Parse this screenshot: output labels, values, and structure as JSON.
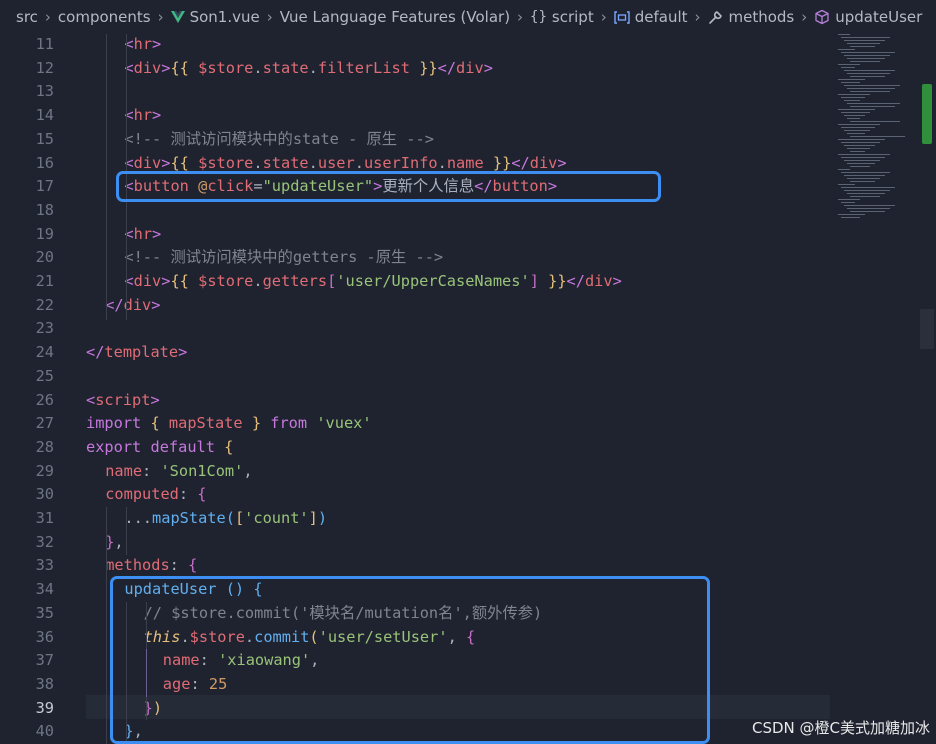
{
  "breadcrumb": {
    "items": [
      {
        "label": "src",
        "icon": ""
      },
      {
        "label": "components",
        "icon": ""
      },
      {
        "label": "Son1.vue",
        "icon": "vue-icon"
      },
      {
        "label": "Vue Language Features (Volar)",
        "icon": ""
      },
      {
        "label": "script",
        "icon": "braces-icon"
      },
      {
        "label": "default",
        "icon": "module-icon"
      },
      {
        "label": "methods",
        "icon": "wrench-icon"
      },
      {
        "label": "updateUser",
        "icon": "cube-icon"
      }
    ]
  },
  "editor": {
    "active_line": "39",
    "lines": [
      {
        "n": "11",
        "indent": 2,
        "tokens": [
          [
            "p",
            "<"
          ],
          [
            "c",
            "hr"
          ],
          [
            "p",
            ">"
          ]
        ]
      },
      {
        "n": "12",
        "indent": 2,
        "tokens": [
          [
            "p",
            "<"
          ],
          [
            "c",
            "div"
          ],
          [
            "p",
            ">"
          ],
          [
            "b",
            "{{"
          ],
          [
            "d",
            " "
          ],
          [
            "c",
            "$store"
          ],
          [
            "d",
            "."
          ],
          [
            "c",
            "state"
          ],
          [
            "d",
            "."
          ],
          [
            "c",
            "filterList"
          ],
          [
            "d",
            " "
          ],
          [
            "b",
            "}}"
          ],
          [
            "p",
            "</"
          ],
          [
            "c",
            "div"
          ],
          [
            "p",
            ">"
          ]
        ]
      },
      {
        "n": "13",
        "indent": 0,
        "tokens": []
      },
      {
        "n": "14",
        "indent": 2,
        "tokens": [
          [
            "p",
            "<"
          ],
          [
            "c",
            "hr"
          ],
          [
            "p",
            ">"
          ]
        ]
      },
      {
        "n": "15",
        "indent": 2,
        "tokens": [
          [
            "m",
            "<!-- 测试访问模块中的state - 原生 -->"
          ]
        ]
      },
      {
        "n": "16",
        "indent": 2,
        "tokens": [
          [
            "p",
            "<"
          ],
          [
            "c",
            "div"
          ],
          [
            "p",
            ">"
          ],
          [
            "b",
            "{{"
          ],
          [
            "d",
            " "
          ],
          [
            "c",
            "$store"
          ],
          [
            "d",
            "."
          ],
          [
            "c",
            "state"
          ],
          [
            "d",
            "."
          ],
          [
            "c",
            "user"
          ],
          [
            "d",
            "."
          ],
          [
            "c",
            "userInfo"
          ],
          [
            "d",
            "."
          ],
          [
            "c",
            "name"
          ],
          [
            "d",
            " "
          ],
          [
            "b",
            "}}"
          ],
          [
            "p",
            "</"
          ],
          [
            "c",
            "div"
          ],
          [
            "p",
            ">"
          ]
        ]
      },
      {
        "n": "17",
        "indent": 2,
        "tokens": [
          [
            "p",
            "<"
          ],
          [
            "c",
            "button"
          ],
          [
            "d",
            " "
          ],
          [
            "n",
            "@"
          ],
          [
            "c",
            "click"
          ],
          [
            "d",
            "="
          ],
          [
            "s",
            "\"updateUser\""
          ],
          [
            "p",
            ">"
          ],
          [
            "d",
            "更新个人信息"
          ],
          [
            "p",
            "</"
          ],
          [
            "c",
            "button"
          ],
          [
            "p",
            ">"
          ]
        ]
      },
      {
        "n": "18",
        "indent": 0,
        "tokens": []
      },
      {
        "n": "19",
        "indent": 2,
        "tokens": [
          [
            "p",
            "<"
          ],
          [
            "c",
            "hr"
          ],
          [
            "p",
            ">"
          ]
        ]
      },
      {
        "n": "20",
        "indent": 2,
        "tokens": [
          [
            "m",
            "<!-- 测试访问模块中的getters -原生 -->"
          ]
        ]
      },
      {
        "n": "21",
        "indent": 2,
        "tokens": [
          [
            "p",
            "<"
          ],
          [
            "c",
            "div"
          ],
          [
            "p",
            ">"
          ],
          [
            "b",
            "{{"
          ],
          [
            "d",
            " "
          ],
          [
            "c",
            "$store"
          ],
          [
            "d",
            "."
          ],
          [
            "c",
            "getters"
          ],
          [
            "k",
            "["
          ],
          [
            "s",
            "'user/UpperCaseNames'"
          ],
          [
            "k",
            "]"
          ],
          [
            "d",
            " "
          ],
          [
            "b",
            "}}"
          ],
          [
            "p",
            "</"
          ],
          [
            "c",
            "div"
          ],
          [
            "p",
            ">"
          ]
        ]
      },
      {
        "n": "22",
        "indent": 1,
        "tokens": [
          [
            "p",
            "</"
          ],
          [
            "c",
            "div"
          ],
          [
            "p",
            ">"
          ]
        ]
      },
      {
        "n": "23",
        "indent": 0,
        "tokens": []
      },
      {
        "n": "24",
        "indent": 0,
        "tokens": [
          [
            "p",
            "</"
          ],
          [
            "c",
            "template"
          ],
          [
            "p",
            ">"
          ]
        ]
      },
      {
        "n": "25",
        "indent": 0,
        "tokens": []
      },
      {
        "n": "26",
        "indent": 0,
        "tokens": [
          [
            "p",
            "<"
          ],
          [
            "c",
            "script"
          ],
          [
            "p",
            ">"
          ]
        ]
      },
      {
        "n": "27",
        "indent": 0,
        "tokens": [
          [
            "u",
            "import"
          ],
          [
            "d",
            " "
          ],
          [
            "b",
            "{"
          ],
          [
            "d",
            " "
          ],
          [
            "c",
            "mapState"
          ],
          [
            "d",
            " "
          ],
          [
            "b",
            "}"
          ],
          [
            "d",
            " "
          ],
          [
            "u",
            "from"
          ],
          [
            "d",
            " "
          ],
          [
            "s",
            "'vuex'"
          ]
        ]
      },
      {
        "n": "28",
        "indent": 0,
        "tokens": [
          [
            "u",
            "export"
          ],
          [
            "d",
            " "
          ],
          [
            "u",
            "default"
          ],
          [
            "d",
            " "
          ],
          [
            "b",
            "{"
          ]
        ]
      },
      {
        "n": "29",
        "indent": 1,
        "tokens": [
          [
            "c",
            "name"
          ],
          [
            "d",
            ": "
          ],
          [
            "s",
            "'Son1Com'"
          ],
          [
            "d",
            ","
          ]
        ]
      },
      {
        "n": "30",
        "indent": 1,
        "tokens": [
          [
            "c",
            "computed"
          ],
          [
            "d",
            ": "
          ],
          [
            "k",
            "{"
          ]
        ]
      },
      {
        "n": "31",
        "indent": 2,
        "tokens": [
          [
            "d",
            "..."
          ],
          [
            "f",
            "mapState"
          ],
          [
            "f",
            "("
          ],
          [
            "b",
            "["
          ],
          [
            "s",
            "'count'"
          ],
          [
            "b",
            "]"
          ],
          [
            "f",
            ")"
          ]
        ]
      },
      {
        "n": "32",
        "indent": 1,
        "tokens": [
          [
            "k",
            "}"
          ],
          [
            "d",
            ","
          ]
        ]
      },
      {
        "n": "33",
        "indent": 1,
        "tokens": [
          [
            "c",
            "methods"
          ],
          [
            "d",
            ": "
          ],
          [
            "k",
            "{"
          ]
        ]
      },
      {
        "n": "34",
        "indent": 2,
        "tokens": [
          [
            "f",
            "updateUser"
          ],
          [
            "d",
            " "
          ],
          [
            "f",
            "()"
          ],
          [
            "d",
            " "
          ],
          [
            "f",
            "{"
          ]
        ]
      },
      {
        "n": "35",
        "indent": 3,
        "tokens": [
          [
            "m",
            "// $store.commit('模块名/mutation名',额外传参)"
          ]
        ]
      },
      {
        "n": "36",
        "indent": 3,
        "tokens": [
          [
            "i",
            "this"
          ],
          [
            "d",
            "."
          ],
          [
            "c",
            "$store"
          ],
          [
            "d",
            "."
          ],
          [
            "f",
            "commit"
          ],
          [
            "b",
            "("
          ],
          [
            "s",
            "'user/setUser'"
          ],
          [
            "d",
            ", "
          ],
          [
            "k",
            "{"
          ]
        ]
      },
      {
        "n": "37",
        "indent": 4,
        "tokens": [
          [
            "c",
            "name"
          ],
          [
            "d",
            ": "
          ],
          [
            "s",
            "'xiaowang'"
          ],
          [
            "d",
            ","
          ]
        ]
      },
      {
        "n": "38",
        "indent": 4,
        "tokens": [
          [
            "c",
            "age"
          ],
          [
            "d",
            ": "
          ],
          [
            "n",
            "25"
          ]
        ]
      },
      {
        "n": "39",
        "indent": 3,
        "tokens": [
          [
            "k",
            "}"
          ],
          [
            "b",
            ")"
          ]
        ]
      },
      {
        "n": "40",
        "indent": 2,
        "tokens": [
          [
            "f",
            "}"
          ],
          [
            "d",
            ","
          ]
        ]
      }
    ]
  },
  "highlight_color": "#3d8ef2",
  "watermark": "CSDN @橙C美式加糖加冰"
}
